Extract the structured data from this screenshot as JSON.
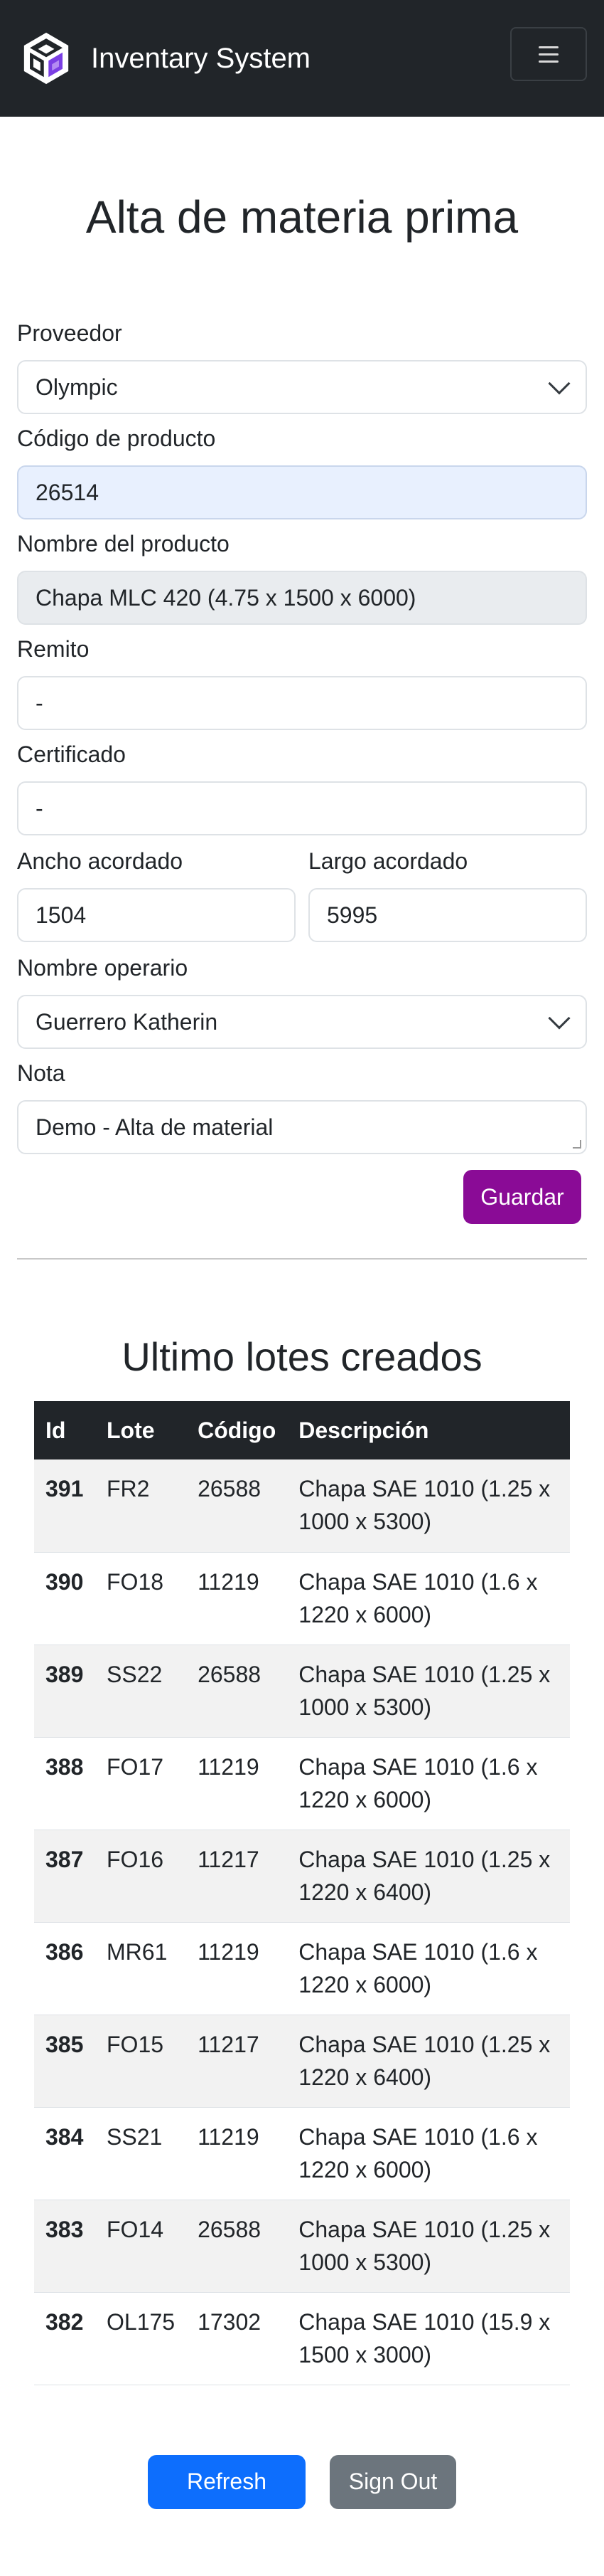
{
  "navbar": {
    "brand": "Inventary System"
  },
  "form": {
    "title": "Alta de materia prima",
    "proveedor": {
      "label": "Proveedor",
      "value": "Olympic"
    },
    "codigo": {
      "label": "Código de producto",
      "value": "26514"
    },
    "nombre": {
      "label": "Nombre del producto",
      "value": "Chapa MLC 420 (4.75 x 1500 x 6000)"
    },
    "remito": {
      "label": "Remito",
      "value": "-"
    },
    "certificado": {
      "label": "Certificado",
      "value": "-"
    },
    "ancho": {
      "label": "Ancho acordado",
      "value": "1504"
    },
    "largo": {
      "label": "Largo acordado",
      "value": "5995"
    },
    "operario": {
      "label": "Nombre operario",
      "value": "Guerrero Katherin"
    },
    "nota": {
      "label": "Nota",
      "value": "Demo - Alta de material"
    },
    "save_label": "Guardar"
  },
  "table": {
    "title": "Ultimo lotes creados",
    "headers": [
      "Id",
      "Lote",
      "Código",
      "Descripción"
    ],
    "rows": [
      {
        "id": "391",
        "lote": "FR2",
        "codigo": "26588",
        "descripcion": "Chapa SAE 1010 (1.25 x 1000 x 5300)"
      },
      {
        "id": "390",
        "lote": "FO18",
        "codigo": "11219",
        "descripcion": "Chapa SAE 1010 (1.6 x 1220 x 6000)"
      },
      {
        "id": "389",
        "lote": "SS22",
        "codigo": "26588",
        "descripcion": "Chapa SAE 1010 (1.25 x 1000 x 5300)"
      },
      {
        "id": "388",
        "lote": "FO17",
        "codigo": "11219",
        "descripcion": "Chapa SAE 1010 (1.6 x 1220 x 6000)"
      },
      {
        "id": "387",
        "lote": "FO16",
        "codigo": "11217",
        "descripcion": "Chapa SAE 1010 (1.25 x 1220 x 6400)"
      },
      {
        "id": "386",
        "lote": "MR61",
        "codigo": "11219",
        "descripcion": "Chapa SAE 1010 (1.6 x 1220 x 6000)"
      },
      {
        "id": "385",
        "lote": "FO15",
        "codigo": "11217",
        "descripcion": "Chapa SAE 1010 (1.25 x 1220 x 6400)"
      },
      {
        "id": "384",
        "lote": "SS21",
        "codigo": "11219",
        "descripcion": "Chapa SAE 1010 (1.6 x 1220 x 6000)"
      },
      {
        "id": "383",
        "lote": "FO14",
        "codigo": "26588",
        "descripcion": "Chapa SAE 1010 (1.25 x 1000 x 5300)"
      },
      {
        "id": "382",
        "lote": "OL175",
        "codigo": "17302",
        "descripcion": "Chapa SAE 1010 (15.9 x 1500 x 3000)"
      }
    ]
  },
  "actions": {
    "refresh_label": "Refresh",
    "signout_label": "Sign Out"
  },
  "colors": {
    "navbar": "#212529",
    "save_button": "#8a0b96",
    "refresh_button": "#0d6efd",
    "signout_button": "#6c757d",
    "selected_field": "#e8f0fe",
    "readonly_field": "#e9ecef"
  }
}
